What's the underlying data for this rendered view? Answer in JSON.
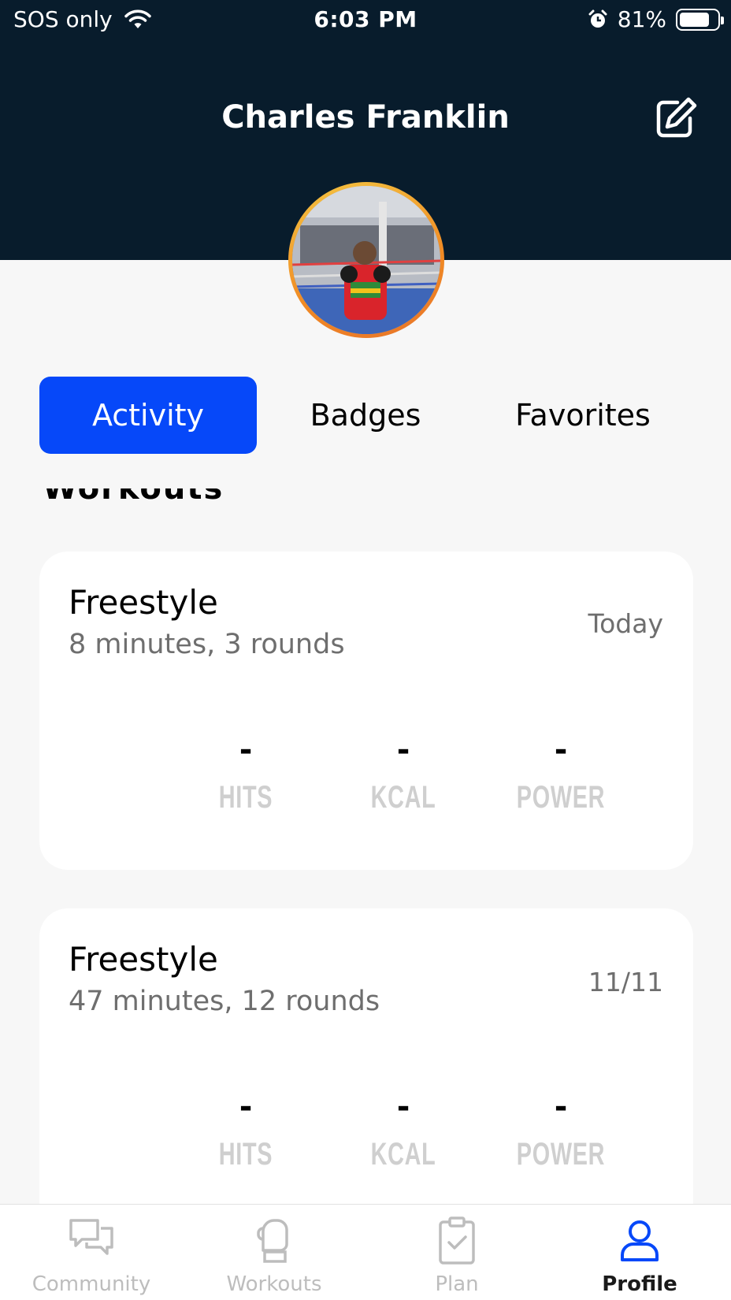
{
  "status_bar": {
    "carrier": "SOS only",
    "time": "6:03 PM",
    "battery_percent": "81%",
    "battery_level": 0.81
  },
  "header": {
    "name": "Charles Franklin",
    "edit_icon": "edit-icon",
    "background_color": "#081c2c"
  },
  "tabs": [
    {
      "label": "Activity",
      "active": true
    },
    {
      "label": "Badges",
      "active": false
    },
    {
      "label": "Favorites",
      "active": false
    }
  ],
  "accent_color": "#0648f9",
  "section_title": "Workouts",
  "workouts": [
    {
      "title": "Freestyle",
      "subtitle": "8 minutes, 3 rounds",
      "date": "Today",
      "stats": [
        {
          "value": "-",
          "label": "HITS"
        },
        {
          "value": "-",
          "label": "KCAL"
        },
        {
          "value": "-",
          "label": "POWER"
        }
      ]
    },
    {
      "title": "Freestyle",
      "subtitle": "47 minutes, 12 rounds",
      "date": "11/11",
      "stats": [
        {
          "value": "-",
          "label": "HITS"
        },
        {
          "value": "-",
          "label": "KCAL"
        },
        {
          "value": "-",
          "label": "POWER"
        }
      ]
    }
  ],
  "bottom_nav": [
    {
      "label": "Community",
      "icon": "chat-bubbles-icon",
      "active": false
    },
    {
      "label": "Workouts",
      "icon": "boxing-glove-icon",
      "active": false
    },
    {
      "label": "Plan",
      "icon": "clipboard-check-icon",
      "active": false
    },
    {
      "label": "Profile",
      "icon": "person-icon",
      "active": true
    }
  ]
}
